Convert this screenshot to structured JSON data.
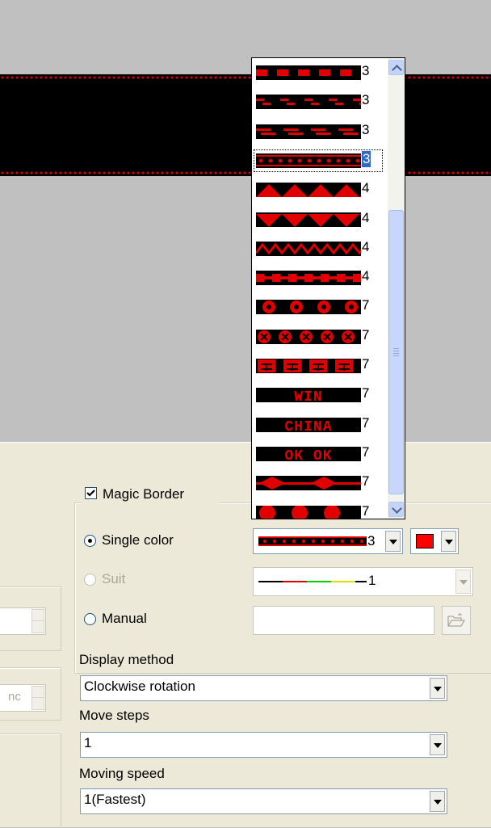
{
  "magic_border": {
    "label": "Magic Border",
    "checked": true
  },
  "options": {
    "single_color": "Single color",
    "suit": "Suit",
    "manual": "Manual",
    "selected": "single_color"
  },
  "pattern_combo": {
    "value": "3"
  },
  "suit_combo": {
    "value": "1"
  },
  "color_combo": {
    "color": "#ff0000"
  },
  "display_method": {
    "label": "Display method",
    "value": "Clockwise rotation"
  },
  "move_steps": {
    "label": "Move steps",
    "value": "1"
  },
  "moving_speed": {
    "label": "Moving speed",
    "value": "1(Fastest)"
  },
  "left_spin_2": {
    "value": "nc"
  },
  "dropdown": {
    "items": [
      {
        "pattern": "dash",
        "value": "3"
      },
      {
        "pattern": "double-dash",
        "value": "3"
      },
      {
        "pattern": "triple-dash",
        "value": "3"
      },
      {
        "pattern": "dots",
        "value": "3",
        "selected": true
      },
      {
        "pattern": "triangles-up",
        "value": "4"
      },
      {
        "pattern": "triangles-down",
        "value": "4"
      },
      {
        "pattern": "zigzag",
        "value": "4"
      },
      {
        "pattern": "blocks",
        "value": "4"
      },
      {
        "pattern": "rings",
        "value": "7"
      },
      {
        "pattern": "crossed-circles",
        "value": "7"
      },
      {
        "pattern": "glyphs",
        "value": "7"
      },
      {
        "pattern": "text",
        "value": "7",
        "text": "WIN"
      },
      {
        "pattern": "text",
        "value": "7",
        "text": "CHINA"
      },
      {
        "pattern": "text",
        "value": "7",
        "text": "OK OK"
      },
      {
        "pattern": "diamonds",
        "value": "7"
      },
      {
        "pattern": "circles",
        "value": "7"
      }
    ]
  },
  "colors": {
    "accent": "#ff0000",
    "selection": "#316ac5",
    "panel": "#ece9d8"
  }
}
